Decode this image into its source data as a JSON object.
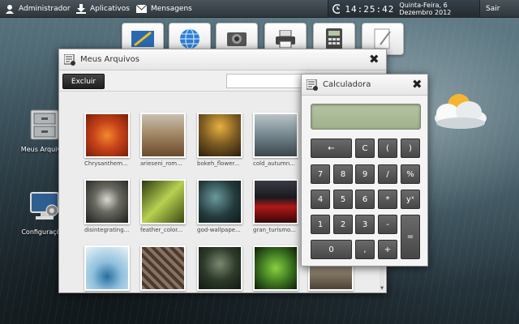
{
  "topbar": {
    "menu": [
      {
        "label": "Administrador",
        "icon": "user-icon"
      },
      {
        "label": "Aplicativos",
        "icon": "download-icon"
      },
      {
        "label": "Mensagens",
        "icon": "mail-icon"
      }
    ],
    "clock_time": "14:25:42",
    "clock_date": "Quinta-Feira, 6 Dezembro 2012",
    "logout_label": "Sair"
  },
  "dock": [
    "graphics-app-icon",
    "browser-globe-icon",
    "media-app-icon",
    "printer-icon",
    "calculator-icon",
    "document-icon"
  ],
  "desktop_icons": [
    {
      "label": "Meus Arquivos",
      "icon": "file-cabinet-icon"
    },
    {
      "label": "Configurações",
      "icon": "settings-monitor-icon"
    }
  ],
  "files_window": {
    "title": "Meus Arquivos",
    "delete_label": "Excluir",
    "search_value": "",
    "files": [
      {
        "name": "Chrysanthem...",
        "color": "#c8441a"
      },
      {
        "name": "arieseni_rom...",
        "color": "#8c6a48"
      },
      {
        "name": "bokeh_flower...",
        "color": "#7a5a22"
      },
      {
        "name": "cold_autumn...",
        "color": "#5d6e76"
      },
      {
        "name": "disintegrating...",
        "color": "#3a3a36"
      },
      {
        "name": "feather_color...",
        "color": "#8a9e3a"
      },
      {
        "name": "god-wallpape...",
        "color": "#243a3c"
      },
      {
        "name": "gran_turismo...",
        "color": "#5a1010"
      },
      {
        "name": "",
        "color": "#5c8eb0"
      },
      {
        "name": "",
        "color": "#6a584a"
      },
      {
        "name": "",
        "color": "#2e3a2a"
      },
      {
        "name": "",
        "color": "#3f7a22"
      }
    ]
  },
  "calculator": {
    "title": "Calculadora",
    "display": "",
    "keys": [
      "←",
      "C",
      "(",
      ")",
      "7",
      "8",
      "9",
      "/",
      "%",
      "4",
      "5",
      "6",
      "*",
      "yˣ",
      "1",
      "2",
      "3",
      "-",
      "=",
      "0",
      ",",
      "+"
    ]
  },
  "colors": {
    "accent_dark": "#2f373c",
    "calc_display": "#b5c4a4"
  }
}
